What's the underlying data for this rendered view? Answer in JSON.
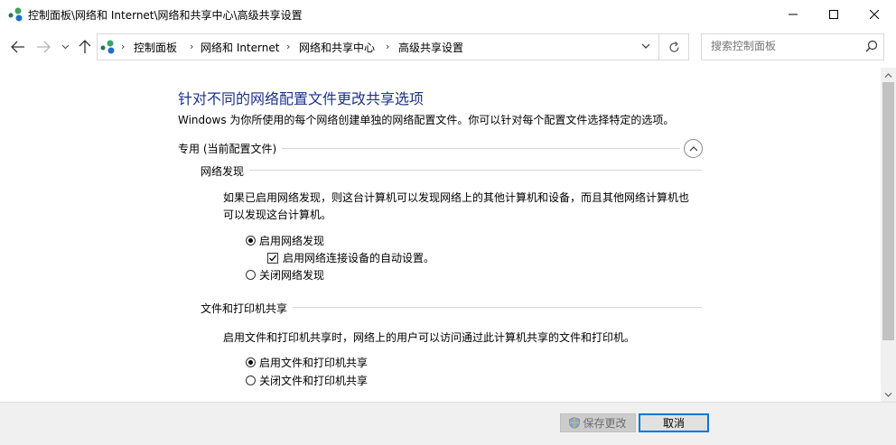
{
  "window": {
    "title": "控制面板\\网络和 Internet\\网络和共享中心\\高级共享设置",
    "minimize_icon": "minimize-icon",
    "maximize_icon": "maximize-icon",
    "close_icon": "close-icon"
  },
  "nav": {
    "breadcrumbs": [
      "控制面板",
      "网络和 Internet",
      "网络和共享中心",
      "高级共享设置"
    ],
    "search_placeholder": "搜索控制面板"
  },
  "content": {
    "heading": "针对不同的网络配置文件更改共享选项",
    "description": "Windows 为你所使用的每个网络创建单独的网络配置文件。你可以针对每个配置文件选择特定的选项。",
    "profile_label": "专用 (当前配置文件)",
    "network_discovery": {
      "title": "网络发现",
      "description_line1": "如果已启用网络发现，则这台计算机可以发现网络上的其他计算机和设备，而且其他网络计算机也",
      "description_line2": "可以发现这台计算机。",
      "options": [
        {
          "label": "启用网络发现",
          "selected": true
        },
        {
          "label": "关闭网络发现",
          "selected": false
        }
      ],
      "auto_setup_label": "启用网络连接设备的自动设置。",
      "auto_setup_checked": true
    },
    "file_printer_sharing": {
      "title": "文件和打印机共享",
      "description": "启用文件和打印机共享时，网络上的用户可以访问通过此计算机共享的文件和打印机。",
      "options": [
        {
          "label": "启用文件和打印机共享",
          "selected": true
        },
        {
          "label": "关闭文件和打印机共享",
          "selected": false
        }
      ]
    }
  },
  "footer": {
    "save_label": "保存更改",
    "cancel_label": "取消"
  },
  "colors": {
    "heading": "#1e3287",
    "accent": "#0078d7"
  }
}
